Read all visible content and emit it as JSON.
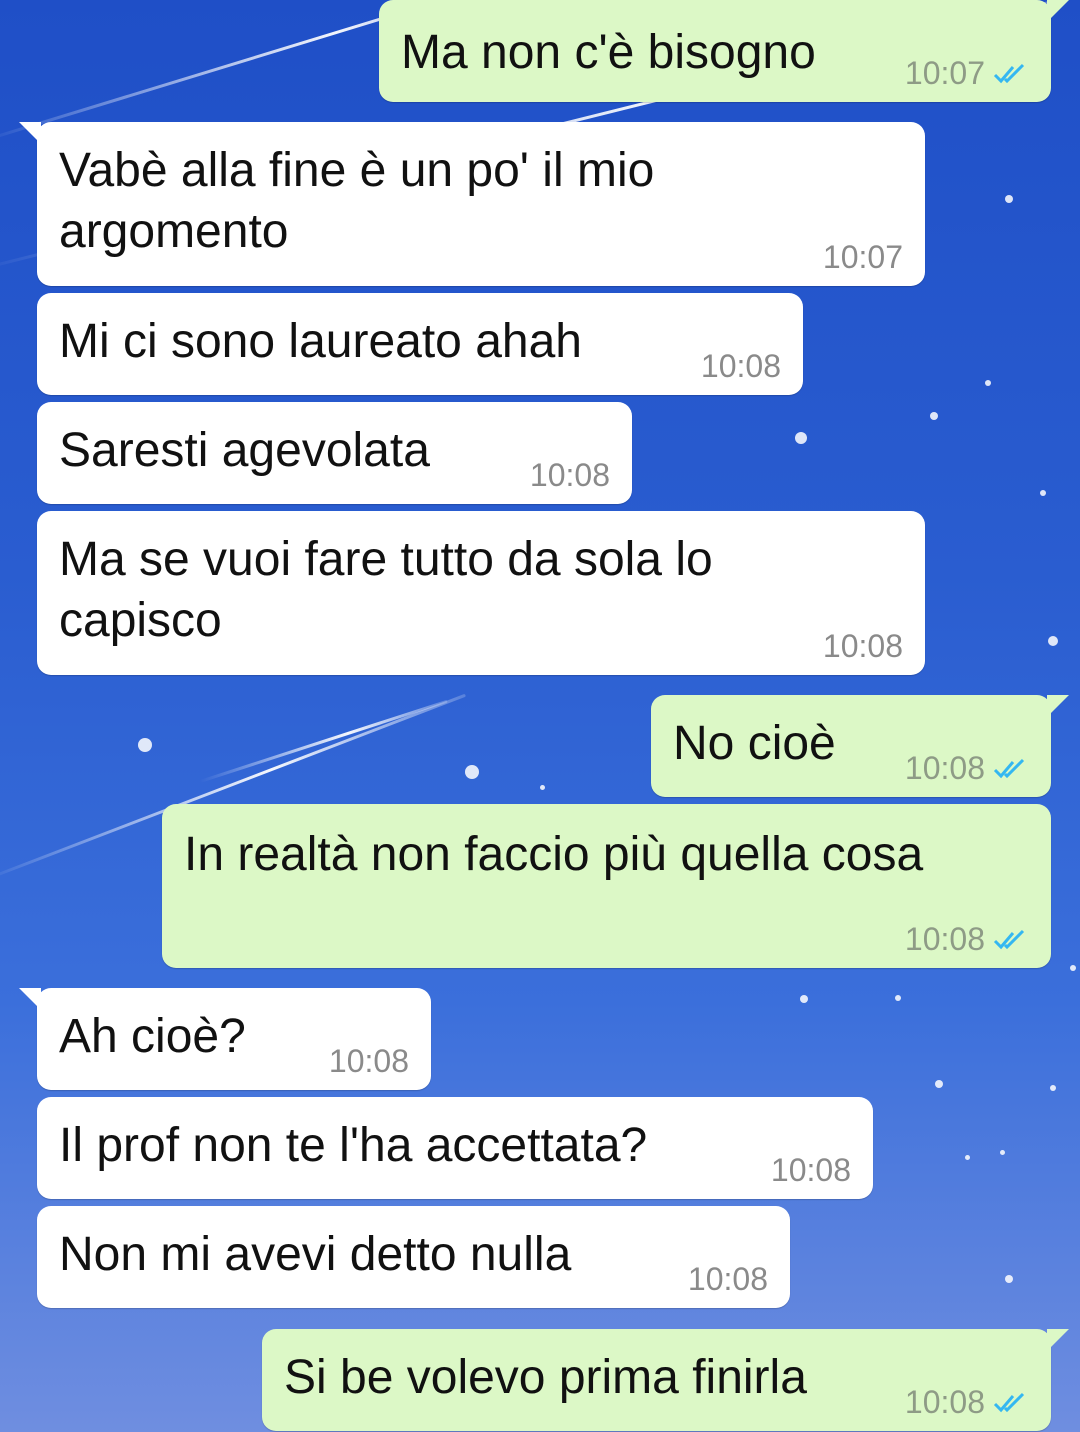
{
  "colors": {
    "outgoing_bubble": "#dcf8c6",
    "incoming_bubble": "#ffffff",
    "read_ticks": "#34b7f1"
  },
  "messages": [
    {
      "direction": "out",
      "text": "Ma non c'è bisogno",
      "time": "10:07",
      "status": "read-double-tick-icon"
    },
    {
      "direction": "in",
      "text": "Vabè alla fine è un po' il mio\nargomento",
      "time": "10:07"
    },
    {
      "direction": "in",
      "text": "Mi ci sono laureato ahah",
      "time": "10:08"
    },
    {
      "direction": "in",
      "text": "Saresti agevolata",
      "time": "10:08"
    },
    {
      "direction": "in",
      "text": "Ma se vuoi fare tutto da sola lo\ncapisco",
      "time": "10:08"
    },
    {
      "direction": "out",
      "text": "No cioè",
      "time": "10:08",
      "status": "read-double-tick-icon"
    },
    {
      "direction": "out",
      "text": "In realtà non faccio più quella cosa",
      "time": "10:08",
      "status": "read-double-tick-icon"
    },
    {
      "direction": "in",
      "text": "Ah cioè?",
      "time": "10:08"
    },
    {
      "direction": "in",
      "text": "Il prof non te l'ha accettata?",
      "time": "10:08"
    },
    {
      "direction": "in",
      "text": "Non mi avevi detto nulla",
      "time": "10:08"
    },
    {
      "direction": "out",
      "text": "Si be volevo prima finirla",
      "time": "10:08",
      "status": "read-double-tick-icon"
    }
  ]
}
